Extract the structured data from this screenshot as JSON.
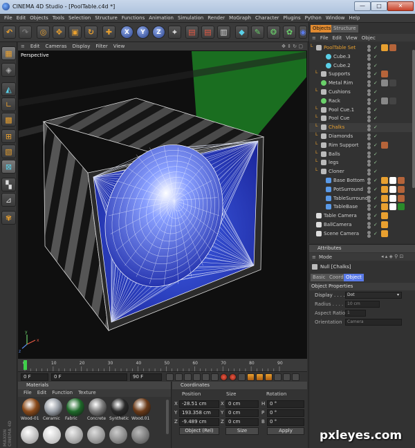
{
  "window": {
    "title": "CINEMA 4D Studio - [PoolTable.c4d *]",
    "min": "—",
    "max": "□",
    "close": "✕"
  },
  "menubar": [
    "File",
    "Edit",
    "Objects",
    "Tools",
    "Selection",
    "Structure",
    "Functions",
    "Animation",
    "Simulation",
    "Render",
    "MoGraph",
    "Character",
    "Plugins",
    "Python",
    "Window",
    "Help"
  ],
  "toolbar": {
    "axis_x": "X",
    "axis_y": "Y",
    "axis_z": "Z"
  },
  "viewport": {
    "menu": [
      "Edit",
      "Cameras",
      "Display",
      "Filter",
      "View"
    ],
    "camera": "Perspective",
    "axis_labels": {
      "x": "x",
      "y": "y",
      "z": "z"
    }
  },
  "timeline": {
    "ticks": [
      "0",
      "10",
      "20",
      "30",
      "40",
      "50",
      "60",
      "70",
      "80",
      "90"
    ],
    "current_frame": "0 F",
    "start": "0 F",
    "end": "90 F",
    "range_start": "0 F",
    "range_end": "90 F"
  },
  "materials": {
    "title": "Materials",
    "menu": [
      "File",
      "Edit",
      "Function",
      "Texture"
    ],
    "items": [
      {
        "label": "Wood-01",
        "color": "#8a4a1a"
      },
      {
        "label": "Ceramic",
        "color": "#9aa0a8"
      },
      {
        "label": "Fabric",
        "color": "#1f6a2a"
      },
      {
        "label": "Concrete",
        "color": "#7a7a7a"
      },
      {
        "label": "Synthetic",
        "color": "#2a2a2a"
      },
      {
        "label": "Wood.01",
        "color": "#6a3a18"
      }
    ]
  },
  "coordinates": {
    "title": "Coordinates",
    "headers": [
      "Position",
      "Size",
      "Rotation"
    ],
    "rows": [
      {
        "axis": "X",
        "position": "-28.51 cm",
        "size_axis": "X",
        "size": "0 cm",
        "rot_axis": "H",
        "rotation": "0 °"
      },
      {
        "axis": "Y",
        "position": "193.358 cm",
        "size_axis": "Y",
        "size": "0 cm",
        "rot_axis": "P",
        "rotation": "0 °"
      },
      {
        "axis": "Z",
        "position": "-9.489 cm",
        "size_axis": "Z",
        "size": "0 cm",
        "rot_axis": "B",
        "rotation": "0 °"
      }
    ],
    "mode": "Object (Rel)",
    "size_mode": "Size",
    "apply": "Apply"
  },
  "objects": {
    "tabs": [
      "Objects",
      "Structure"
    ],
    "menu": [
      "File",
      "Edit",
      "View",
      "Objec"
    ],
    "items": [
      {
        "name": "PoolTable Set",
        "indent": 0,
        "color": "#e8a030",
        "icon": "null"
      },
      {
        "name": "Cube.3",
        "indent": 2,
        "color": "#cfcfcf",
        "icon": "cube"
      },
      {
        "name": "Cube.2",
        "indent": 2,
        "color": "#cfcfcf",
        "icon": "cube"
      },
      {
        "name": "Supports",
        "indent": 1,
        "color": "#cfcfcf",
        "icon": "null"
      },
      {
        "name": "Metal Rim",
        "indent": 1,
        "color": "#cfcfcf",
        "icon": "nurbs"
      },
      {
        "name": "Cushions",
        "indent": 1,
        "color": "#cfcfcf",
        "icon": "null"
      },
      {
        "name": "Rack",
        "indent": 1,
        "color": "#cfcfcf",
        "icon": "nurbs"
      },
      {
        "name": "Pool Cue.1",
        "indent": 1,
        "color": "#cfcfcf",
        "icon": "null"
      },
      {
        "name": "Pool Cue",
        "indent": 1,
        "color": "#cfcfcf",
        "icon": "null"
      },
      {
        "name": "Chalks",
        "indent": 1,
        "color": "#e8a030",
        "icon": "null"
      },
      {
        "name": "Diamonds",
        "indent": 1,
        "color": "#cfcfcf",
        "icon": "null"
      },
      {
        "name": "Rim Support",
        "indent": 1,
        "color": "#cfcfcf",
        "icon": "null"
      },
      {
        "name": "Balls",
        "indent": 1,
        "color": "#cfcfcf",
        "icon": "null"
      },
      {
        "name": "legs",
        "indent": 1,
        "color": "#cfcfcf",
        "icon": "null"
      },
      {
        "name": "Cloner",
        "indent": 1,
        "color": "#cfcfcf",
        "icon": "null"
      },
      {
        "name": "Base Bottom",
        "indent": 2,
        "color": "#cfcfcf",
        "icon": "poly"
      },
      {
        "name": "PotSurround",
        "indent": 2,
        "color": "#cfcfcf",
        "icon": "poly"
      },
      {
        "name": "TableSurround",
        "indent": 2,
        "color": "#cfcfcf",
        "icon": "poly"
      },
      {
        "name": "TableBase",
        "indent": 2,
        "color": "#cfcfcf",
        "icon": "poly"
      },
      {
        "name": "Table Camera",
        "indent": 0,
        "color": "#cfcfcf",
        "icon": "camera"
      },
      {
        "name": "BallCamera",
        "indent": 0,
        "color": "#cfcfcf",
        "icon": "camera"
      },
      {
        "name": "Scene Camera",
        "indent": 0,
        "color": "#cfcfcf",
        "icon": "camera"
      }
    ]
  },
  "attributes": {
    "title": "Attributes",
    "mode": "Mode",
    "object_label": "Null [Chalks]",
    "tabs": [
      "Basic",
      "Coord.",
      "Object"
    ],
    "section": "Object Properties",
    "fields": [
      {
        "label": "Display . . . .",
        "value": "Dot",
        "enabled": true
      },
      {
        "label": "Radius . . . .",
        "value": "10 cm",
        "enabled": false
      },
      {
        "label": "Aspect Ratio",
        "value": "1",
        "enabled": false
      },
      {
        "label": "Orientation",
        "value": "Camera",
        "enabled": false
      }
    ]
  },
  "branding": {
    "maxon": "MAXON CINEMA 4D",
    "watermark": "pxleyes.com"
  },
  "colors": {
    "accent": "#e8a030",
    "cube_face": "#1f2fb0",
    "wire": "#ffffff",
    "green_band": "#1d7a23"
  }
}
